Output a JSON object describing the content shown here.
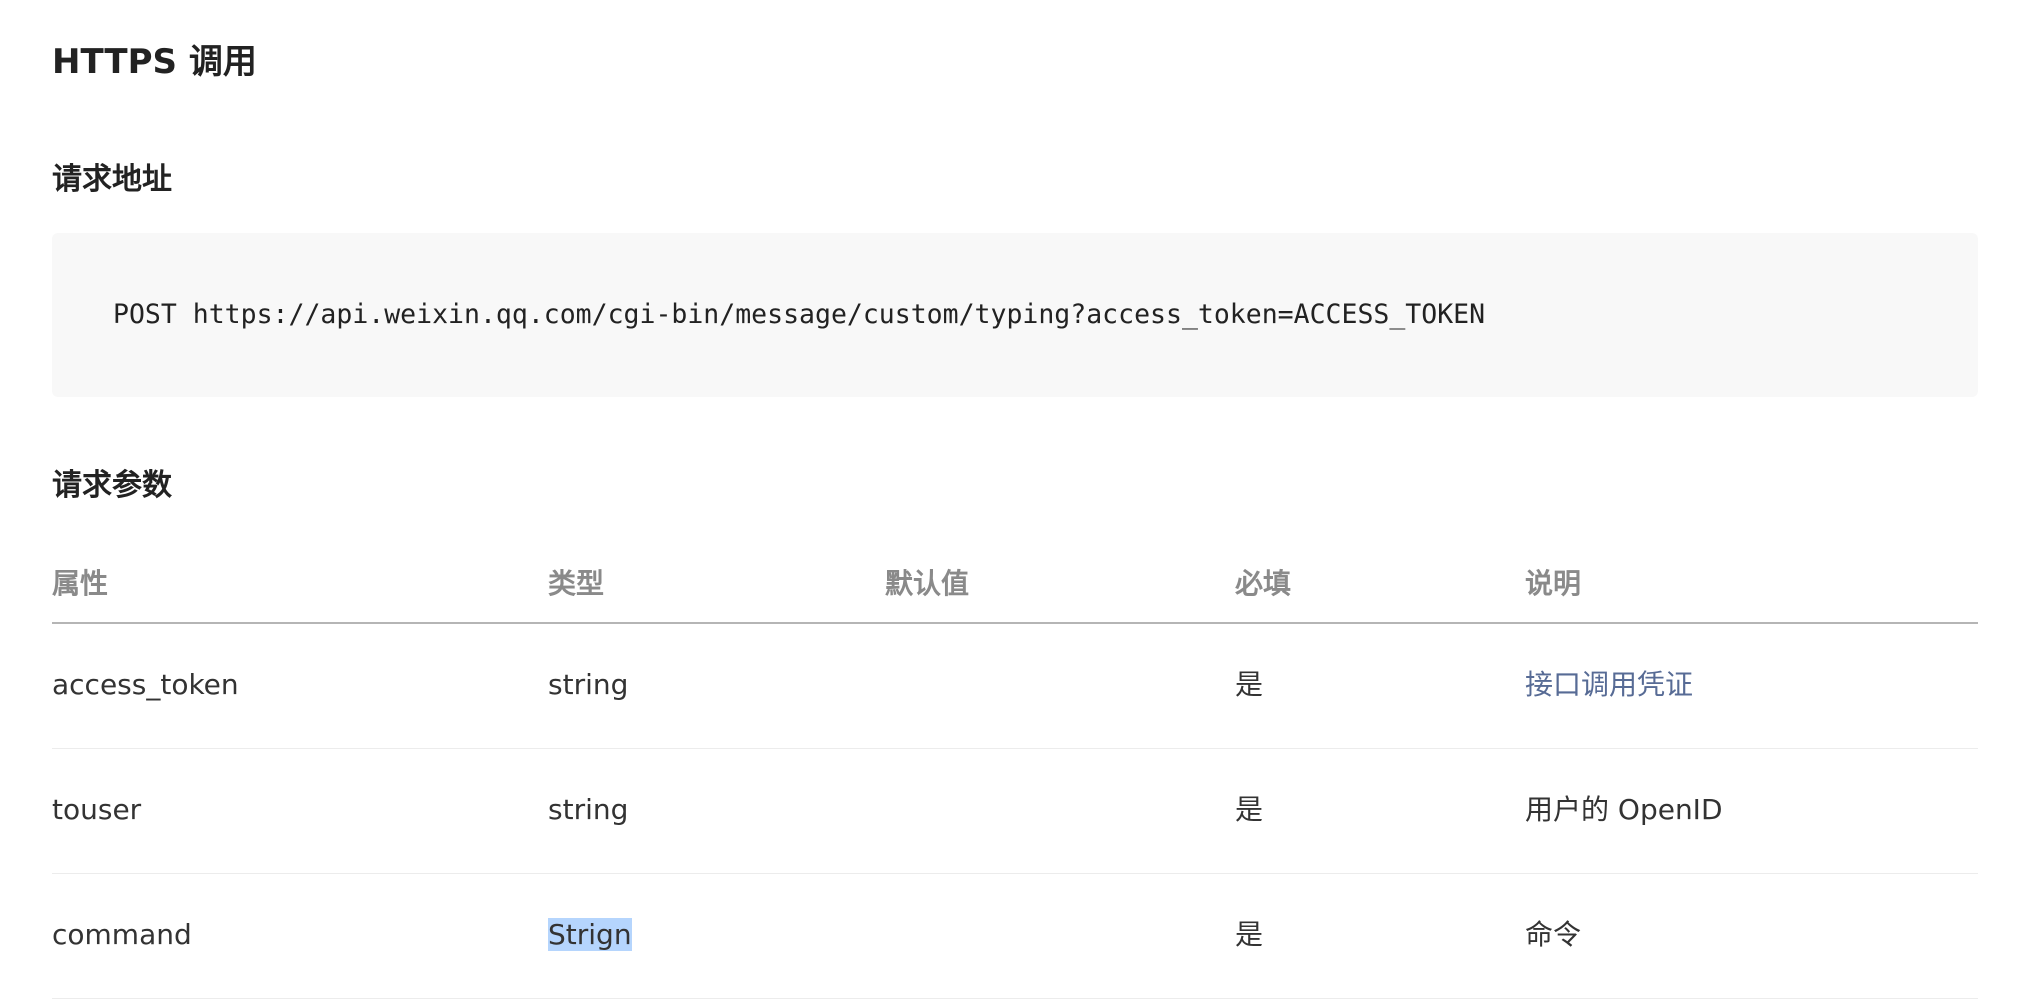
{
  "title": "HTTPS 调用",
  "request_address": {
    "heading": "请求地址",
    "code": "POST https://api.weixin.qq.com/cgi-bin/message/custom/typing?access_token=ACCESS_TOKEN"
  },
  "request_params": {
    "heading": "请求参数",
    "columns": [
      "属性",
      "类型",
      "默认值",
      "必填",
      "说明"
    ],
    "rows": [
      {
        "name": "access_token",
        "type": "string",
        "default": "",
        "required": "是",
        "description": "接口调用凭证"
      },
      {
        "name": "touser",
        "type": "string",
        "default": "",
        "required": "是",
        "description": "用户的 OpenID"
      },
      {
        "name": "command",
        "type": "Strign",
        "default": "",
        "required": "是",
        "description": "命令"
      }
    ]
  },
  "colors": {
    "link": "#576b95",
    "selection": "#b5d5fd",
    "code_background": "#f8f8f8"
  }
}
